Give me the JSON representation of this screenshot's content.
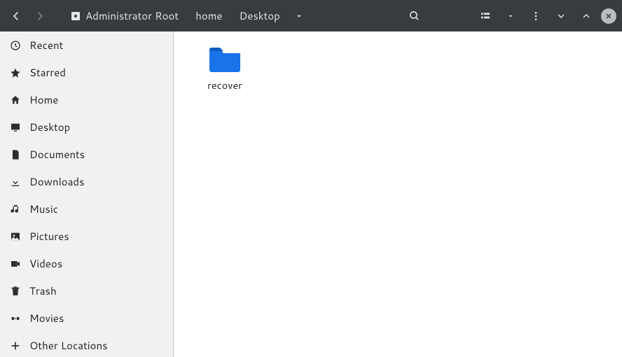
{
  "pathbar": {
    "root_label": "Administrator Root",
    "segments": [
      {
        "label": "home"
      },
      {
        "label": "Desktop"
      }
    ]
  },
  "sidebar": {
    "items": [
      {
        "icon": "recent",
        "label": "Recent"
      },
      {
        "icon": "star",
        "label": "Starred"
      },
      {
        "icon": "home",
        "label": "Home"
      },
      {
        "icon": "desktop",
        "label": "Desktop"
      },
      {
        "icon": "documents",
        "label": "Documents"
      },
      {
        "icon": "downloads",
        "label": "Downloads"
      },
      {
        "icon": "music",
        "label": "Music"
      },
      {
        "icon": "pictures",
        "label": "Pictures"
      },
      {
        "icon": "videos",
        "label": "Videos"
      },
      {
        "icon": "trash",
        "label": "Trash"
      }
    ],
    "mounts": [
      {
        "icon": "drive",
        "label": "Movies"
      }
    ],
    "other_locations_label": "Other Locations"
  },
  "content": {
    "items": [
      {
        "type": "folder",
        "label": "recover",
        "color": "#1a73e8"
      }
    ]
  }
}
